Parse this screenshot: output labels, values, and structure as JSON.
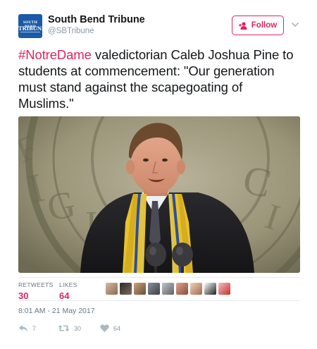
{
  "account": {
    "name": "South Bend Tribune",
    "handle": "@SBTribune",
    "avatar_lines": [
      "SOUTH BEND",
      "TRIBUNE"
    ]
  },
  "follow_button": {
    "label": "Follow"
  },
  "tweet": {
    "hashtag": "#NotreDame",
    "text": " valedictorian Caleb Joshua Pine to students at commencement: \"Our generation must stand against the scapegoating of Muslims.\""
  },
  "stats": {
    "retweets_label": "RETWEETS",
    "retweets_value": "30",
    "likes_label": "LIKES",
    "likes_value": "64"
  },
  "timestamp": "8:01 AM - 21 May 2017",
  "actions": {
    "reply_count": "7",
    "retweet_count": "30",
    "like_count": "64"
  },
  "colors": {
    "accent": "#e0245e",
    "muted": "#8899a6",
    "brand_blue": "#1a5aa6"
  }
}
